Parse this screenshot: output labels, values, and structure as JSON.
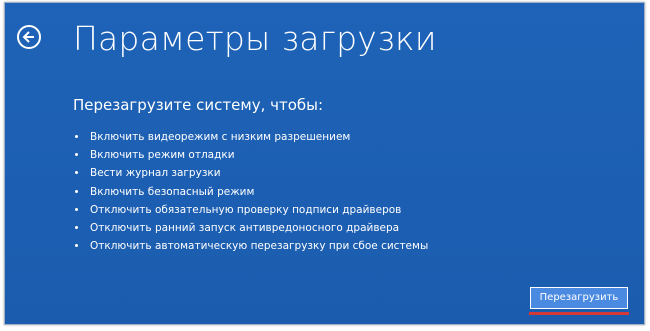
{
  "page": {
    "title": "Параметры загрузки",
    "back_icon": "back-arrow-circle-icon"
  },
  "content": {
    "subtitle": "Перезагрузите систему, чтобы:",
    "options": [
      "Включить видеорежим с низким разрешением",
      "Включить режим отладки",
      "Вести журнал загрузки",
      "Включить безопасный режим",
      "Отключить обязательную проверку подписи драйверов",
      "Отключить ранний запуск антивредоносного драйвера",
      "Отключить автоматическую перезагрузку при сбое системы"
    ]
  },
  "actions": {
    "restart_label": "Перезагрузить",
    "highlight_color": "#d23a3a"
  },
  "colors": {
    "background": "#1d5fb3",
    "button": "#4a8ae0",
    "text": "#ffffff"
  }
}
